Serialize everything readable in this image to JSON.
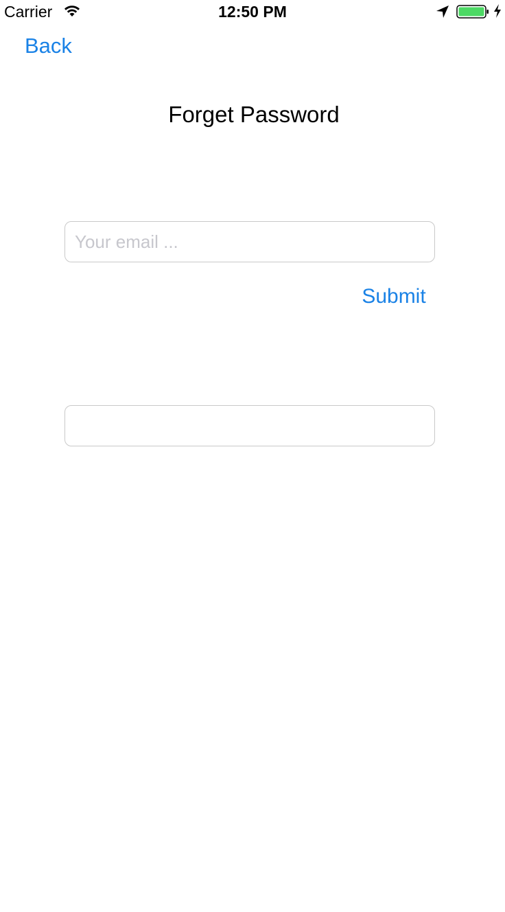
{
  "status_bar": {
    "carrier": "Carrier",
    "time": "12:50 PM",
    "battery_color": "#4cd964",
    "icons": [
      "wifi-icon",
      "location-arrow-icon",
      "battery-icon",
      "charging-bolt-icon"
    ]
  },
  "nav": {
    "back_label": "Back"
  },
  "page": {
    "title": "Forget Password"
  },
  "form": {
    "email_placeholder": "Your email ...",
    "email_value": "",
    "submit_label": "Submit",
    "second_field_value": ""
  },
  "colors": {
    "accent": "#1a82e6",
    "field_border": "#c9c9c9",
    "placeholder": "#c7c7cd"
  }
}
